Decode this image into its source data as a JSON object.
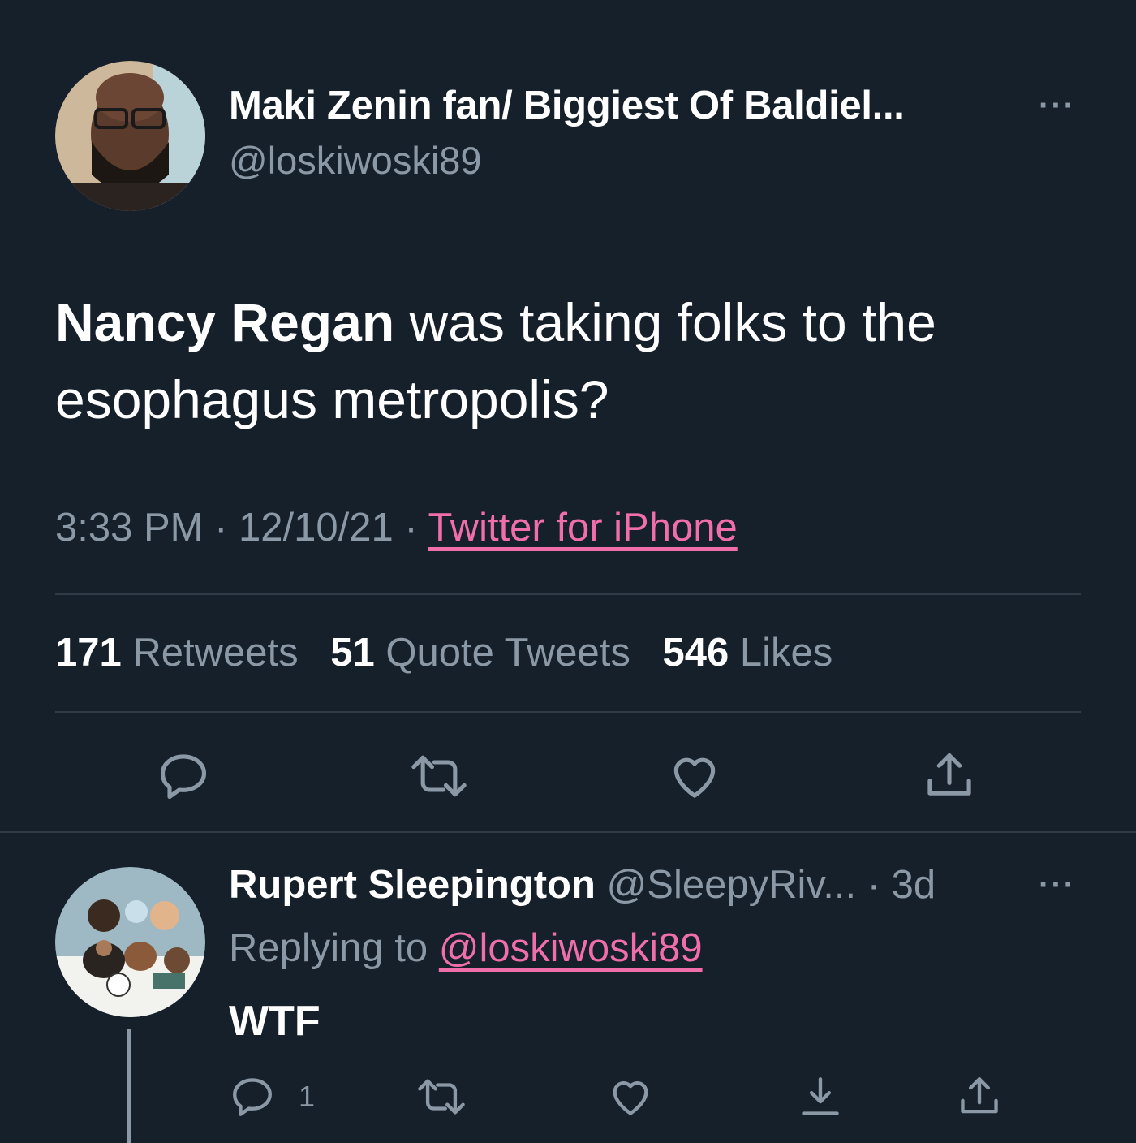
{
  "tweet": {
    "author_name": "Maki Zenin fan/ Biggiest Of Baldiel...",
    "author_handle": "@loskiwoski89",
    "more_label": "···",
    "text_bold": "Nancy Regan",
    "text_rest_line1": " was taking folks to the",
    "text_line2": "esophagus metropolis?",
    "time": "3:33 PM",
    "separator": " · ",
    "date": "12/10/21",
    "source": "Twitter for iPhone",
    "retweets_count": "171",
    "retweets_label": "Retweets",
    "quotes_count": "51",
    "quotes_label": "Quote Tweets",
    "likes_count": "546",
    "likes_label": "Likes"
  },
  "reply": {
    "author_name": "Rupert Sleepington",
    "author_handle": "@SleepyRiv...",
    "age": "3d",
    "more_label": "···",
    "replying_prefix": "Replying to",
    "replying_handle": "@loskiwoski89",
    "text": "WTF",
    "reply_count": "1"
  },
  "colors": {
    "background": "#15202b",
    "secondary_text": "#8b98a5",
    "link": "#f06eaa",
    "divider": "#2f3b47"
  },
  "icons": [
    "reply-icon",
    "retweet-icon",
    "like-icon",
    "share-icon",
    "download-icon",
    "more-icon"
  ]
}
